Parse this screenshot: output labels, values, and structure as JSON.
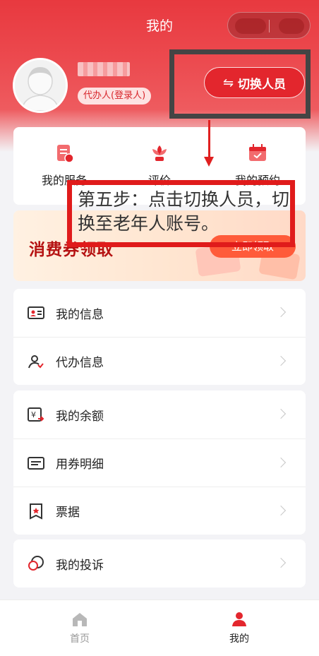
{
  "navbar": {
    "title": "我的"
  },
  "user": {
    "role": "代办人(登录人)"
  },
  "switch_button": {
    "label": "切换人员",
    "icon": "⇋"
  },
  "services": [
    {
      "label": "我的服务",
      "icon": "service-doc-icon"
    },
    {
      "label": "评价",
      "icon": "flower-icon"
    },
    {
      "label": "我的预约",
      "icon": "calendar-icon"
    }
  ],
  "coupon": {
    "title": "消费券领取",
    "button": "立即领取"
  },
  "annotation": {
    "text": "第五步：点击切换人员，切换至老年人账号。"
  },
  "menu_group1": [
    {
      "label": "我的信息"
    },
    {
      "label": "代办信息"
    }
  ],
  "menu_group2": [
    {
      "label": "我的余额"
    },
    {
      "label": "用券明细"
    },
    {
      "label": "票据"
    }
  ],
  "menu_group3": [
    {
      "label": "我的投诉"
    }
  ],
  "tabbar": [
    {
      "label": "首页",
      "active": false
    },
    {
      "label": "我的",
      "active": true
    }
  ],
  "colors": {
    "brand_red": "#e3262d",
    "annotation_red": "#e01b1b",
    "annotation_gray": "#444444"
  }
}
